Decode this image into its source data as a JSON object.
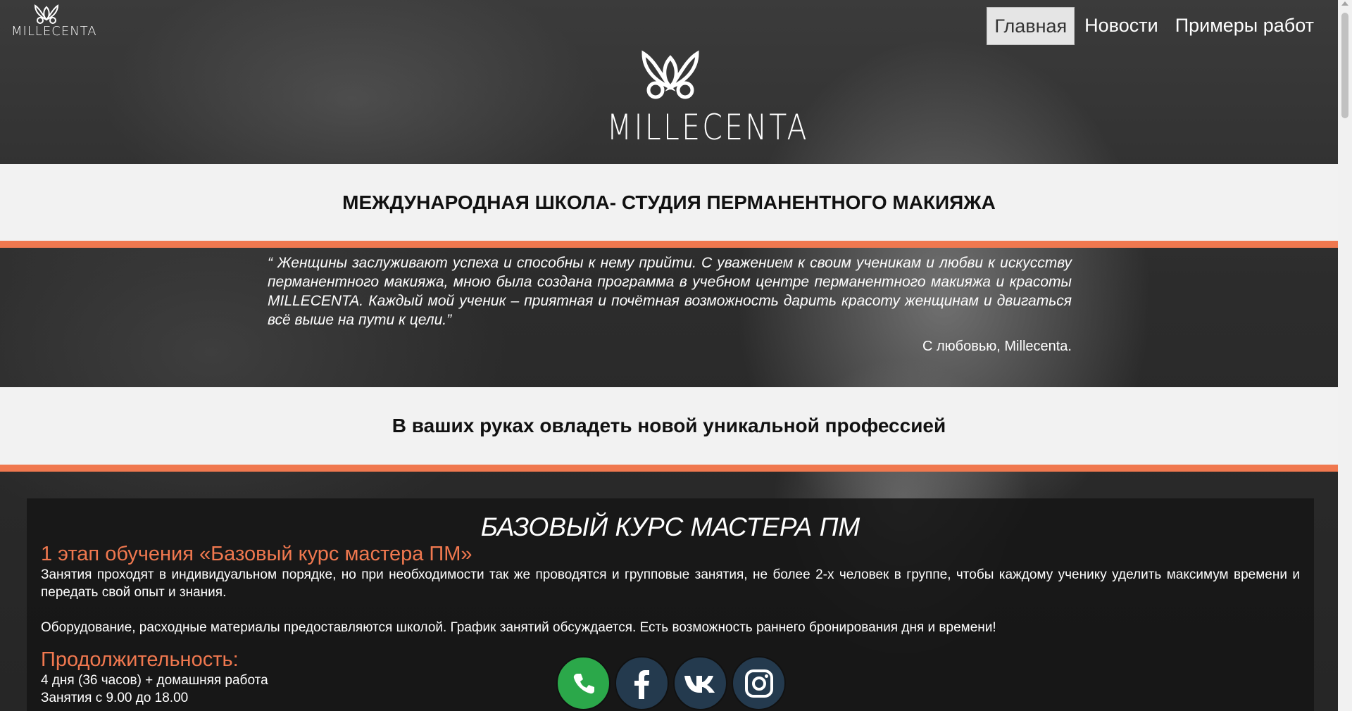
{
  "header": {
    "brand_small": "MILLECENTA",
    "brand_large": "MILLECENTA",
    "nav": [
      "Главная",
      "Новости",
      "Примеры работ"
    ]
  },
  "band1": {
    "title": "МЕЖДУНАРОДНАЯ ШКОЛА- СТУДИЯ ПЕРМАНЕНТНОГО МАКИЯЖА"
  },
  "quote": {
    "text": "“ Женщины заслуживают успеха и способны к нему прийти. С уважением к своим ученикам и любви к искусству перманентного макияжа, мною была создана программа в учебном центре перманентного макияжа и красоты MILLECENTA. Каждый мой ученик – приятная и почётная возможность дарить красоту женщинам и двигаться всё выше на пути к цели.”",
    "signature": "С любовью, Millecenta."
  },
  "band2": {
    "title": "В ваших руках овладеть новой уникальной профессией"
  },
  "course": {
    "title": "БАЗОВЫЙ КУРС МАСТЕРА ПМ",
    "stage": "1 этап обучения «Базовый курс мастера ПМ»",
    "p1": "Занятия проходят в индивидуальном порядке, но при необходимости так же проводятся и групповые занятия, не более 2-х человек в группе, чтобы каждому ученику уделить максимум времени и передать свой опыт и знания.",
    "p2": "Оборудование, расходные материалы предоставляются школой. График занятий обсуждается. Есть возможность раннего бронирования дня и времени!",
    "duration_title": "Продолжительность:",
    "duration_1": "4 дня (36 часов) + домашняя работа",
    "duration_2": "Занятия с 9.00 до 18.00"
  },
  "social": [
    "phone-icon",
    "facebook-icon",
    "vk-icon",
    "instagram-icon"
  ],
  "colors": {
    "accent": "#f0784f",
    "band": "#f2f2f2",
    "whatsapp": "#2ba84a",
    "social_dark": "#243a4e"
  }
}
